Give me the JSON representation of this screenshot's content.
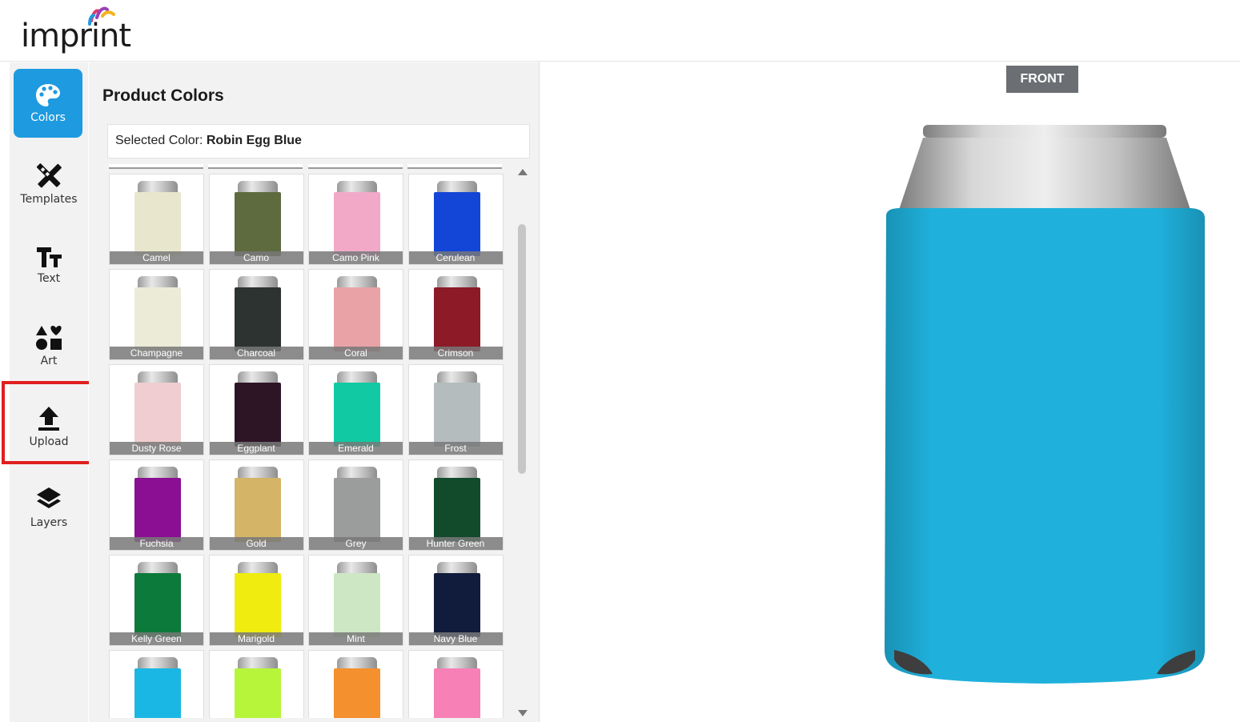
{
  "app": {
    "logo_text": "imprint"
  },
  "sidebar": {
    "items": [
      {
        "label": "Colors",
        "icon": "palette-icon",
        "active": true
      },
      {
        "label": "Templates",
        "icon": "pencil-ruler-icon"
      },
      {
        "label": "Text",
        "icon": "text-icon"
      },
      {
        "label": "Art",
        "icon": "shapes-icon"
      },
      {
        "label": "Upload",
        "icon": "upload-icon"
      },
      {
        "label": "Layers",
        "icon": "layers-icon"
      }
    ]
  },
  "panel": {
    "title": "Product Colors",
    "selected_prefix": "Selected Color: ",
    "selected_value": "Robin Egg Blue"
  },
  "colors": [
    {
      "label": "Camel",
      "hex": "#e8e6cc"
    },
    {
      "label": "Camo",
      "hex": "#5d6b3f"
    },
    {
      "label": "Camo Pink",
      "hex": "#f2a9c8"
    },
    {
      "label": "Cerulean",
      "hex": "#1346d6"
    },
    {
      "label": "Champagne",
      "hex": "#ecebd8"
    },
    {
      "label": "Charcoal",
      "hex": "#2c3330"
    },
    {
      "label": "Coral",
      "hex": "#e9a3a7"
    },
    {
      "label": "Crimson",
      "hex": "#8c1a27"
    },
    {
      "label": "Dusty Rose",
      "hex": "#f0cdd0"
    },
    {
      "label": "Eggplant",
      "hex": "#2d1526"
    },
    {
      "label": "Emerald",
      "hex": "#11c9a2"
    },
    {
      "label": "Frost",
      "hex": "#b4bcbd"
    },
    {
      "label": "Fuchsia",
      "hex": "#8a0f92"
    },
    {
      "label": "Gold",
      "hex": "#d4b467"
    },
    {
      "label": "Grey",
      "hex": "#9a9d9c"
    },
    {
      "label": "Hunter Green",
      "hex": "#124a2c"
    },
    {
      "label": "Kelly Green",
      "hex": "#0c7a3a"
    },
    {
      "label": "Marigold",
      "hex": "#f0ec10"
    },
    {
      "label": "Mint",
      "hex": "#cde7c4"
    },
    {
      "label": "Navy Blue",
      "hex": "#111b3c"
    },
    {
      "label": "",
      "hex": "#1bb7e4"
    },
    {
      "label": "",
      "hex": "#b6f53a"
    },
    {
      "label": "",
      "hex": "#f4902d"
    },
    {
      "label": "",
      "hex": "#f780b6"
    }
  ],
  "preview": {
    "side_button": "FRONT",
    "sleeve_color": "#1fb1dc"
  }
}
